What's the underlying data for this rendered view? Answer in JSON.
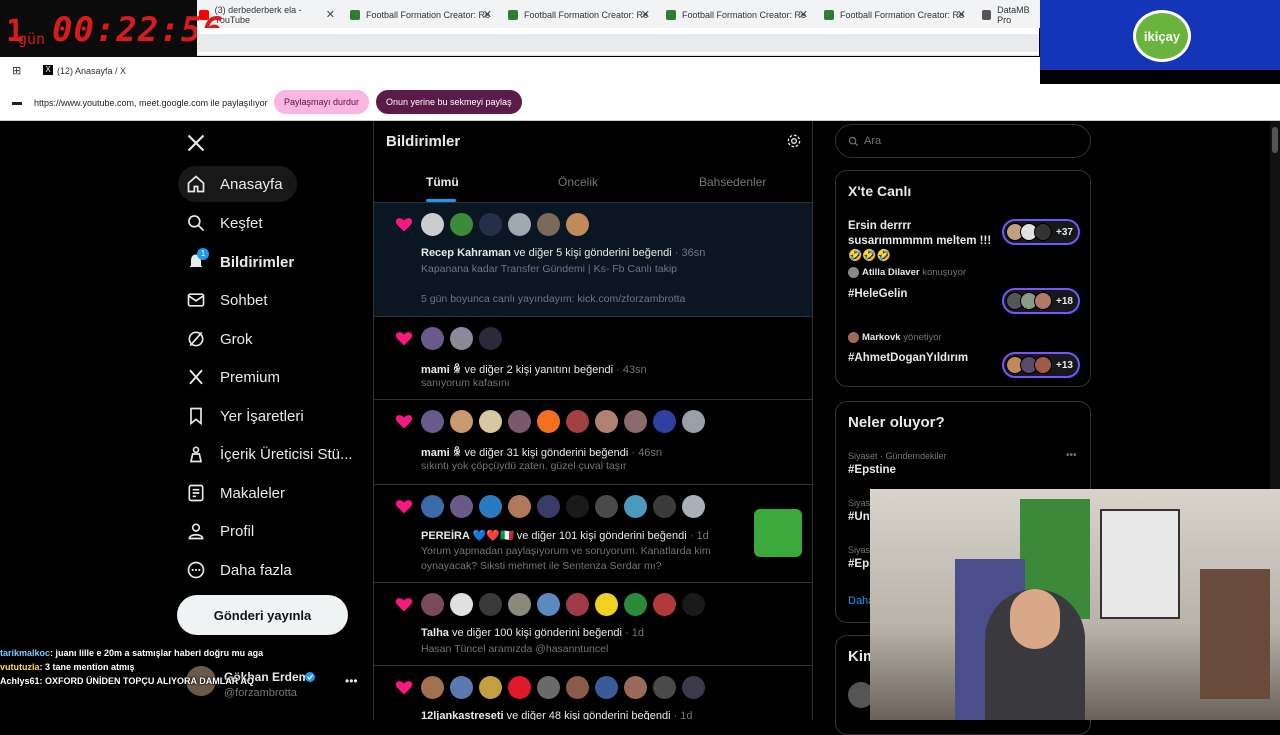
{
  "timer": {
    "days": "1",
    "days_label": "gün",
    "clock": "00:22:56"
  },
  "tabs": [
    {
      "label": "(3) derbederberk ela - YouTube",
      "color": "#ff0000"
    },
    {
      "label": "Football Formation Creator: Re",
      "color": "#2e7d32"
    },
    {
      "label": "Football Formation Creator: Re",
      "color": "#2e7d32"
    },
    {
      "label": "Football Formation Creator: Re",
      "color": "#2e7d32"
    },
    {
      "label": "Football Formation Creator: Re",
      "color": "#2e7d32"
    },
    {
      "label": "DataMB Pro",
      "color": "#555555"
    }
  ],
  "brand_logo": "ikiçay",
  "bookmark": {
    "label": "(12) Anasayfa / X"
  },
  "share_bar": {
    "text": "https://www.youtube.com, meet.google.com ile paylaşılıyor",
    "stop_label": "Paylaşmayı durdur",
    "share_tab_label": "Onun yerine bu sekmeyi paylaş"
  },
  "sidebar": {
    "items": [
      {
        "label": "Anasayfa",
        "icon": "home-icon"
      },
      {
        "label": "Keşfet",
        "icon": "search-icon"
      },
      {
        "label": "Bildirimler",
        "icon": "bell-icon",
        "badge": "1"
      },
      {
        "label": "Sohbet",
        "icon": "mail-icon"
      },
      {
        "label": "Grok",
        "icon": "grok-icon"
      },
      {
        "label": "Premium",
        "icon": "x-icon"
      },
      {
        "label": "Yer İşaretleri",
        "icon": "bookmark-icon"
      },
      {
        "label": "İçerik Üreticisi Stü...",
        "icon": "creator-icon"
      },
      {
        "label": "Makaleler",
        "icon": "article-icon"
      },
      {
        "label": "Profil",
        "icon": "profile-icon"
      },
      {
        "label": "Daha fazla",
        "icon": "more-circle-icon"
      }
    ],
    "post_button": "Gönderi yayınla",
    "account": {
      "name": "Gökhan Erdem",
      "handle": "@forzambrotta"
    }
  },
  "feed": {
    "title": "Bildirimler",
    "tabs": [
      "Tümü",
      "Öncelik",
      "Bahsedenler"
    ],
    "notifications": [
      {
        "who": "Recep Kahraman",
        "rest": " ve diğer 5 kişi gönderini beğendi",
        "time": " · 36sn",
        "line1": "Kapanana kadar Transfer Gündemi | Ks- Fb Canlı takip",
        "line2": "5 gün boyunca canlı yayındayım: kick.com/zforzambrotta"
      },
      {
        "who": "mami ꆜ",
        "rest": " ve diğer 2 kişi yanıtını beğendi",
        "time": " · 43sn",
        "line1": "sanıyorum kafasını",
        "line2": ""
      },
      {
        "who": "mami ꆜ",
        "rest": " ve diğer 31 kişi gönderini beğendi",
        "time": " · 46sn",
        "line1": "sıkıntı yok çöpçüydü zaten. güzel çuval taşır",
        "line2": ""
      },
      {
        "who": "PEREİRA 💙❤️🇮🇹",
        "rest": " ve diğer 101 kişi gönderini beğendi",
        "time": " · 1d",
        "line1": "Yorum yapmadan paylaşıyorum ve soruyorum. Kanatlarda kim",
        "line2": "oynayacak? Siksti mehmet ile Sentenza Serdar mı?"
      },
      {
        "who": "Talha",
        "rest": " ve diğer 100 kişi gönderini beğendi",
        "time": " · 1d",
        "line1": "Hasan Tüncel aramızda @hasanntuncel",
        "line2": ""
      },
      {
        "who": "12ljankastreseti",
        "rest": " ve diğer 48 kişi gönderini beğendi",
        "time": " · 1d",
        "line1": "",
        "line2": ""
      }
    ]
  },
  "right": {
    "search_placeholder": "Ara",
    "live_title": "X'te Canlı",
    "live": [
      {
        "host": "",
        "role": "",
        "title": "Ersin derrrr susarımmmmm meltem !!!🤣🤣🤣",
        "count": "+37"
      },
      {
        "host": "Atilla Dilaver",
        "role": "konuşuyor",
        "title": "#HeleGelin",
        "count": "+18"
      },
      {
        "host": "Markovk",
        "role": "yönetiyor",
        "title": "#AhmetDoganYıldırım",
        "count": "+13"
      }
    ],
    "trends_title": "Neler oluyor?",
    "trends": [
      {
        "context": "Siyaset · Gündemdekiler",
        "name": "#Epstine"
      },
      {
        "context": "Siyaset",
        "name": "#Uni"
      },
      {
        "context": "Siyaset",
        "name": "#Eps"
      }
    ],
    "show_more": "Daha",
    "next_card_title": "Kim"
  },
  "chat": [
    {
      "user": "tarikmalkoc",
      "text": ": juanı lille e 20m a satmışlar haberi doğru mu aga",
      "color": "#7ec8ff"
    },
    {
      "user": "vututuzla",
      "text": ": 3 tane mention atmış",
      "color": "#ffd84a"
    },
    {
      "user": "Achlys61",
      "text": ": OXFORD ÜNİDEN TOPÇU ALIYORA DAMLAR AQ",
      "color": "#ffffff"
    }
  ]
}
